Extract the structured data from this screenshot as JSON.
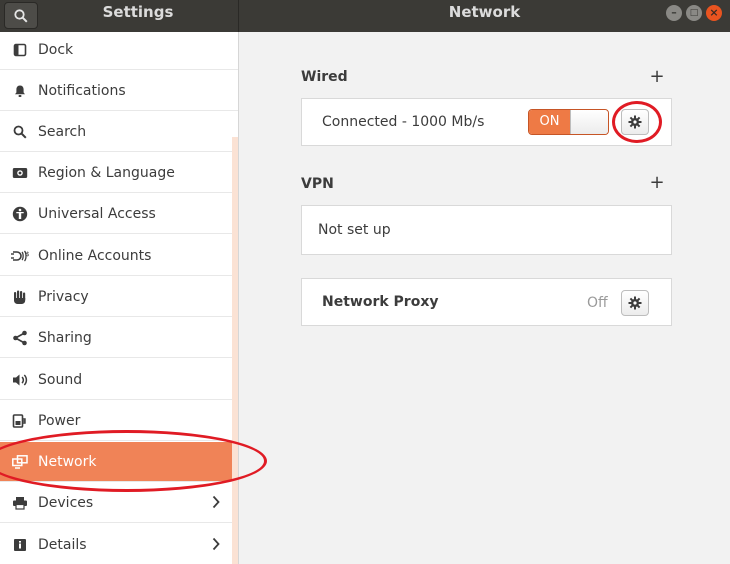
{
  "titlebar": {
    "left_title": "Settings",
    "right_title": "Network",
    "minimize_glyph": "–",
    "maximize_glyph": "□",
    "close_glyph": "×"
  },
  "sidebar": {
    "items": [
      {
        "label": "Dock",
        "icon": "dock-icon"
      },
      {
        "label": "Notifications",
        "icon": "bell-icon"
      },
      {
        "label": "Search",
        "icon": "search-icon"
      },
      {
        "label": "Region & Language",
        "icon": "camera-icon"
      },
      {
        "label": "Universal Access",
        "icon": "accessibility-icon"
      },
      {
        "label": "Online Accounts",
        "icon": "online-accounts-icon"
      },
      {
        "label": "Privacy",
        "icon": "hand-icon"
      },
      {
        "label": "Sharing",
        "icon": "share-icon"
      },
      {
        "label": "Sound",
        "icon": "speaker-icon"
      },
      {
        "label": "Power",
        "icon": "plug-icon"
      },
      {
        "label": "Network",
        "icon": "network-icon",
        "active": true
      },
      {
        "label": "Devices",
        "icon": "printer-icon",
        "chevron": true
      },
      {
        "label": "Details",
        "icon": "details-icon",
        "chevron": true
      }
    ]
  },
  "main": {
    "wired": {
      "title": "Wired",
      "add_glyph": "+",
      "status": "Connected - 1000 Mb/s",
      "toggle_on_label": "ON"
    },
    "vpn": {
      "title": "VPN",
      "add_glyph": "+",
      "empty_label": "Not set up"
    },
    "proxy": {
      "label": "Network Proxy",
      "status": "Off"
    }
  },
  "colors": {
    "accent": "#f08357",
    "toggle_on": "#ee7a45",
    "titlebar": "#3b3a36",
    "annotation": "#e01b24"
  }
}
